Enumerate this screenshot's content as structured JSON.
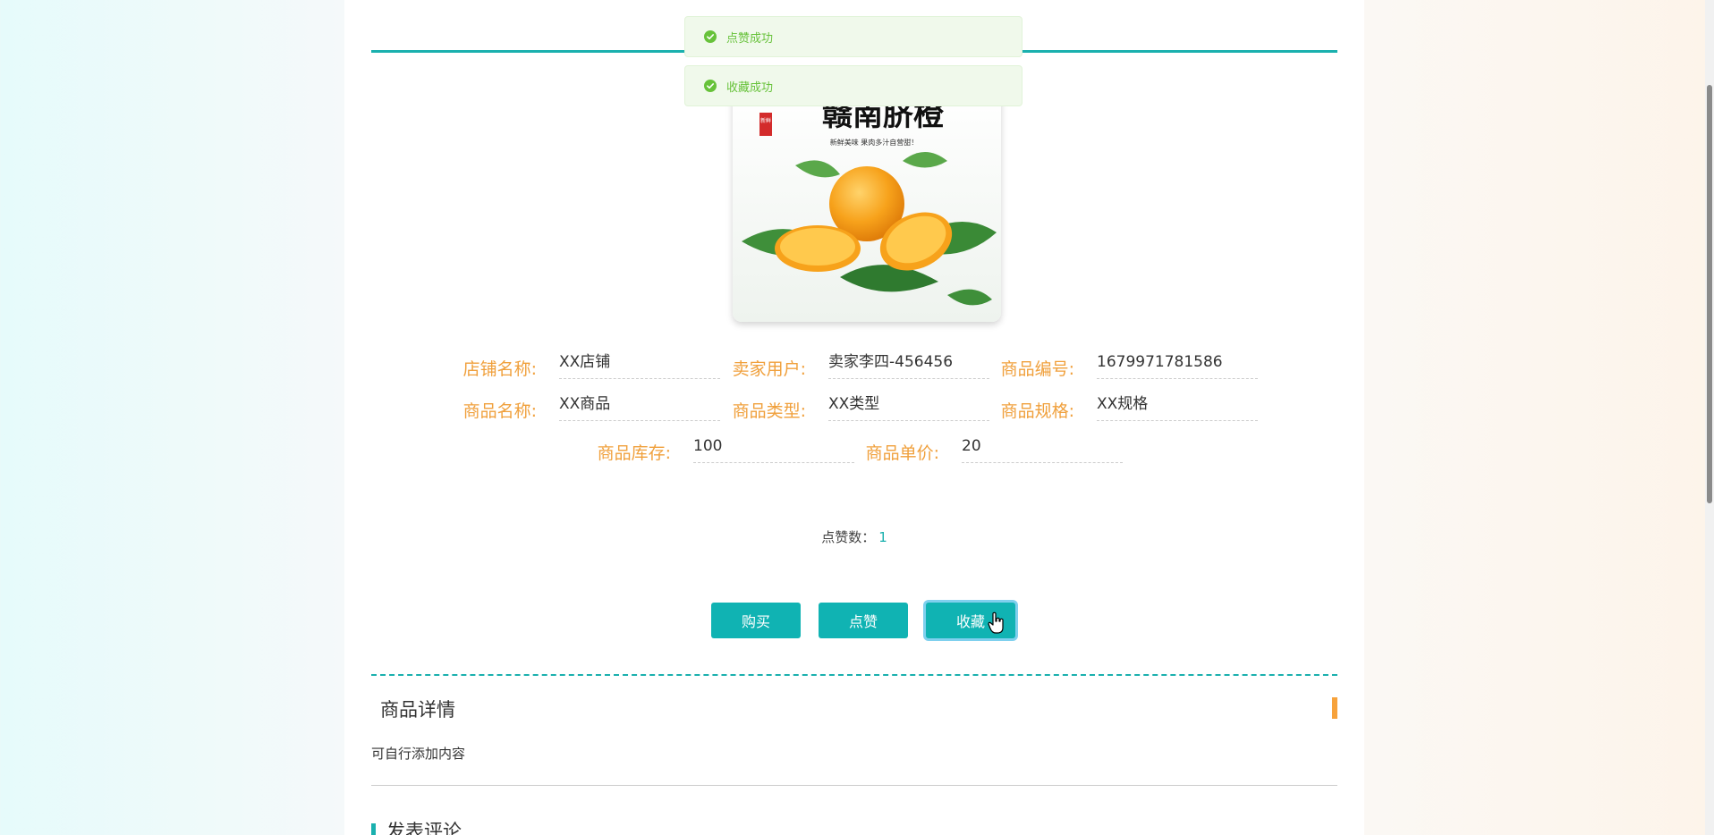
{
  "toasts": [
    {
      "message": "点赞成功"
    },
    {
      "message": "收藏成功"
    }
  ],
  "product_image": {
    "title": "赣南脐橙",
    "subtitle": "新鲜美味 果肉多汁自营甜！",
    "stamp": "新鲜"
  },
  "fields": {
    "shop_name": {
      "label": "店铺名称:",
      "value": "XX店铺"
    },
    "seller": {
      "label": "卖家用户:",
      "value": "卖家李四-456456"
    },
    "product_no": {
      "label": "商品编号:",
      "value": "1679971781586"
    },
    "product_name": {
      "label": "商品名称:",
      "value": "XX商品"
    },
    "product_type": {
      "label": "商品类型:",
      "value": "XX类型"
    },
    "product_spec": {
      "label": "商品规格:",
      "value": "XX规格"
    },
    "stock": {
      "label": "商品库存:",
      "value": "100"
    },
    "price": {
      "label": "商品单价:",
      "value": "20"
    }
  },
  "likes": {
    "label": "点赞数：",
    "count": "1"
  },
  "buttons": {
    "buy": "购买",
    "like": "点赞",
    "favorite": "收藏"
  },
  "details": {
    "title": "商品详情",
    "content": "可自行添加内容"
  },
  "comments": {
    "title": "发表评论"
  },
  "colors": {
    "accent": "#1ab0ae",
    "label": "#f0a03c",
    "success": "#67c23a"
  }
}
